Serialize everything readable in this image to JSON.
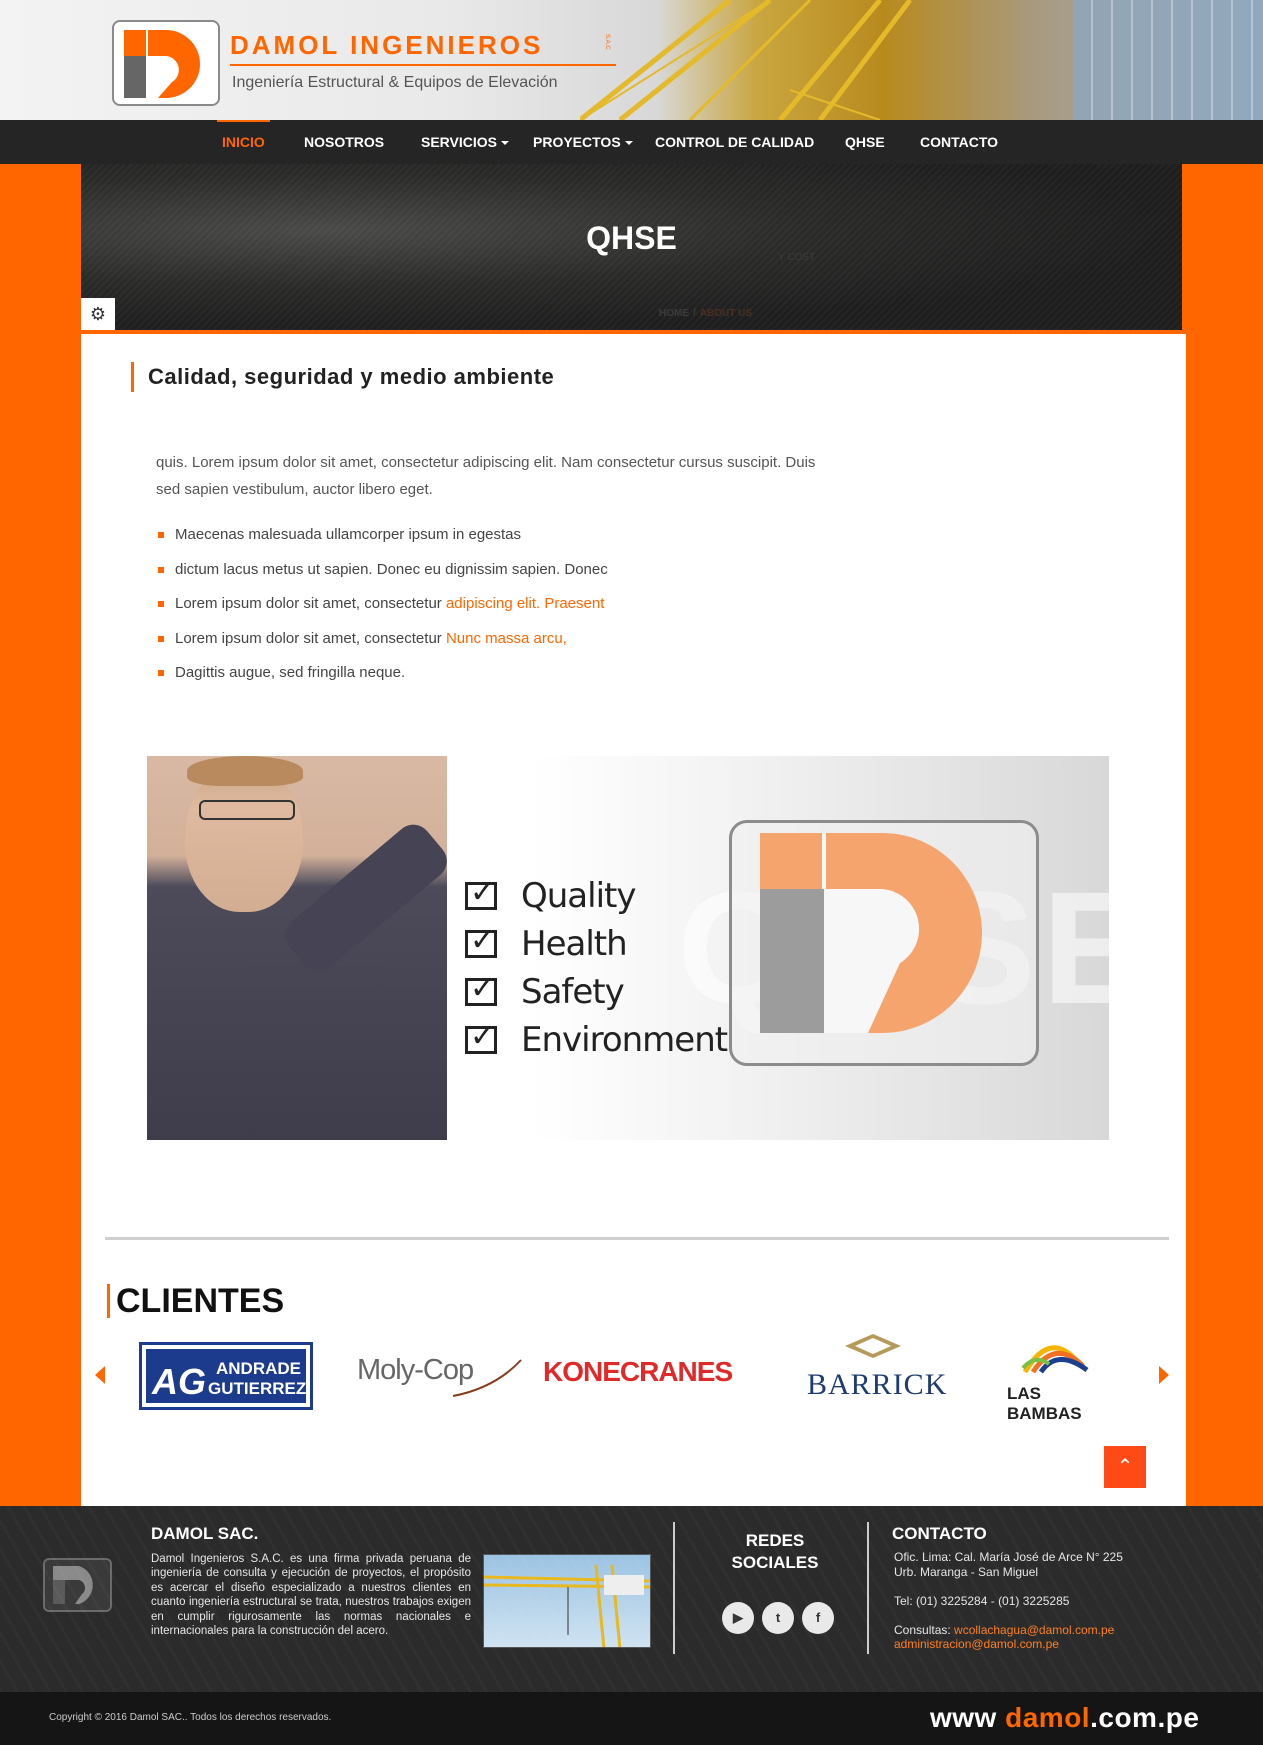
{
  "brand": {
    "name": "DAMOL INGENIEROS",
    "suffix": "S.A.C",
    "tagline": "Ingeniería Estructural & Equipos de Elevación"
  },
  "nav": {
    "items": [
      {
        "label": "INICIO",
        "active": true,
        "dropdown": false
      },
      {
        "label": "NOSOTROS",
        "active": false,
        "dropdown": false
      },
      {
        "label": "SERVICIOS",
        "active": false,
        "dropdown": true
      },
      {
        "label": "PROYECTOS",
        "active": false,
        "dropdown": true
      },
      {
        "label": "CONTROL DE CALIDAD",
        "active": false,
        "dropdown": false
      },
      {
        "label": "QHSE",
        "active": false,
        "dropdown": false
      },
      {
        "label": "CONTACTO",
        "active": false,
        "dropdown": false
      }
    ]
  },
  "banner": {
    "title": "QHSE",
    "ghost_text": "Y COST",
    "breadcrumb_home": "HOME",
    "breadcrumb_sep": "/",
    "breadcrumb_current": "ABOUT US",
    "settings_icon": "gear-icon"
  },
  "content": {
    "section_title": "Calidad, seguridad y medio ambiente",
    "intro": "quis. Lorem ipsum dolor sit amet, consectetur adipiscing elit. Nam consectetur cursus suscipit. Duis sed sapien vestibulum, auctor libero eget.",
    "bullets": [
      {
        "text": "Maecenas malesuada ullamcorper ipsum in egestas",
        "highlight": ""
      },
      {
        "text": "dictum lacus metus ut sapien. Donec eu dignissim sapien. Donec",
        "highlight": ""
      },
      {
        "text": "Lorem ipsum dolor sit amet, consectetur ",
        "highlight": "adipiscing elit. Praesent"
      },
      {
        "text": "Lorem ipsum dolor sit amet, consectetur ",
        "highlight": "Nunc massa arcu,"
      },
      {
        "text": "Dagittis augue, sed fringilla neque.",
        "highlight": ""
      }
    ],
    "qhse_image": {
      "checklist": [
        "Quality",
        "Health",
        "Safety",
        "Environment"
      ],
      "watermark": "QHSE"
    }
  },
  "clients": {
    "title": "CLIENTES",
    "logos": [
      {
        "name": "AG",
        "line1": "ANDRADE",
        "line2": "GUTIERREZ"
      },
      {
        "name": "Moly-Cop"
      },
      {
        "name": "KONECRANES"
      },
      {
        "name": "BARRICK"
      },
      {
        "name": "LAS BAMBAS"
      }
    ],
    "prev_icon": "chevron-left-icon",
    "next_icon": "chevron-right-icon"
  },
  "scroll_top": {
    "icon": "chevron-up-icon",
    "glyph": "⌃"
  },
  "footer": {
    "about_title": "DAMOL SAC.",
    "about_text": "Damol Ingenieros S.A.C. es una firma privada peruana de ingeniería de consulta y ejecución de proyectos, el propósito es acercar el diseño especializado a nuestros clientes en cuanto ingeniería estructural se trata, nuestros trabajos exigen en cumplir rigurosamente las normas nacionales e internacionales para la construcción del acero.",
    "social_title_1": "REDES",
    "social_title_2": "SOCIALES",
    "social_icons": [
      "youtube-icon",
      "twitter-icon",
      "facebook-icon"
    ],
    "contact_title": "CONTACTO",
    "address_1": "Ofic. Lima: Cal. María José de Arce N° 225",
    "address_2": "Urb. Maranga - San Miguel",
    "phone": "Tel: (01) 3225284 - (01) 3225285",
    "consult_label": "Consultas: ",
    "email_1": "wcollachagua@damol.com.pe",
    "email_2": "administracion@damol.com.pe"
  },
  "copyright": "Copyright © 2016 Damol SAC.. Todos los derechos reservados.",
  "site_url": {
    "pre": "www ",
    "brand": "damol",
    "post": ".com.pe"
  },
  "colors": {
    "accent": "#ff6600",
    "nav_bg": "#252525",
    "footer_bg": "#2b2b2b"
  }
}
